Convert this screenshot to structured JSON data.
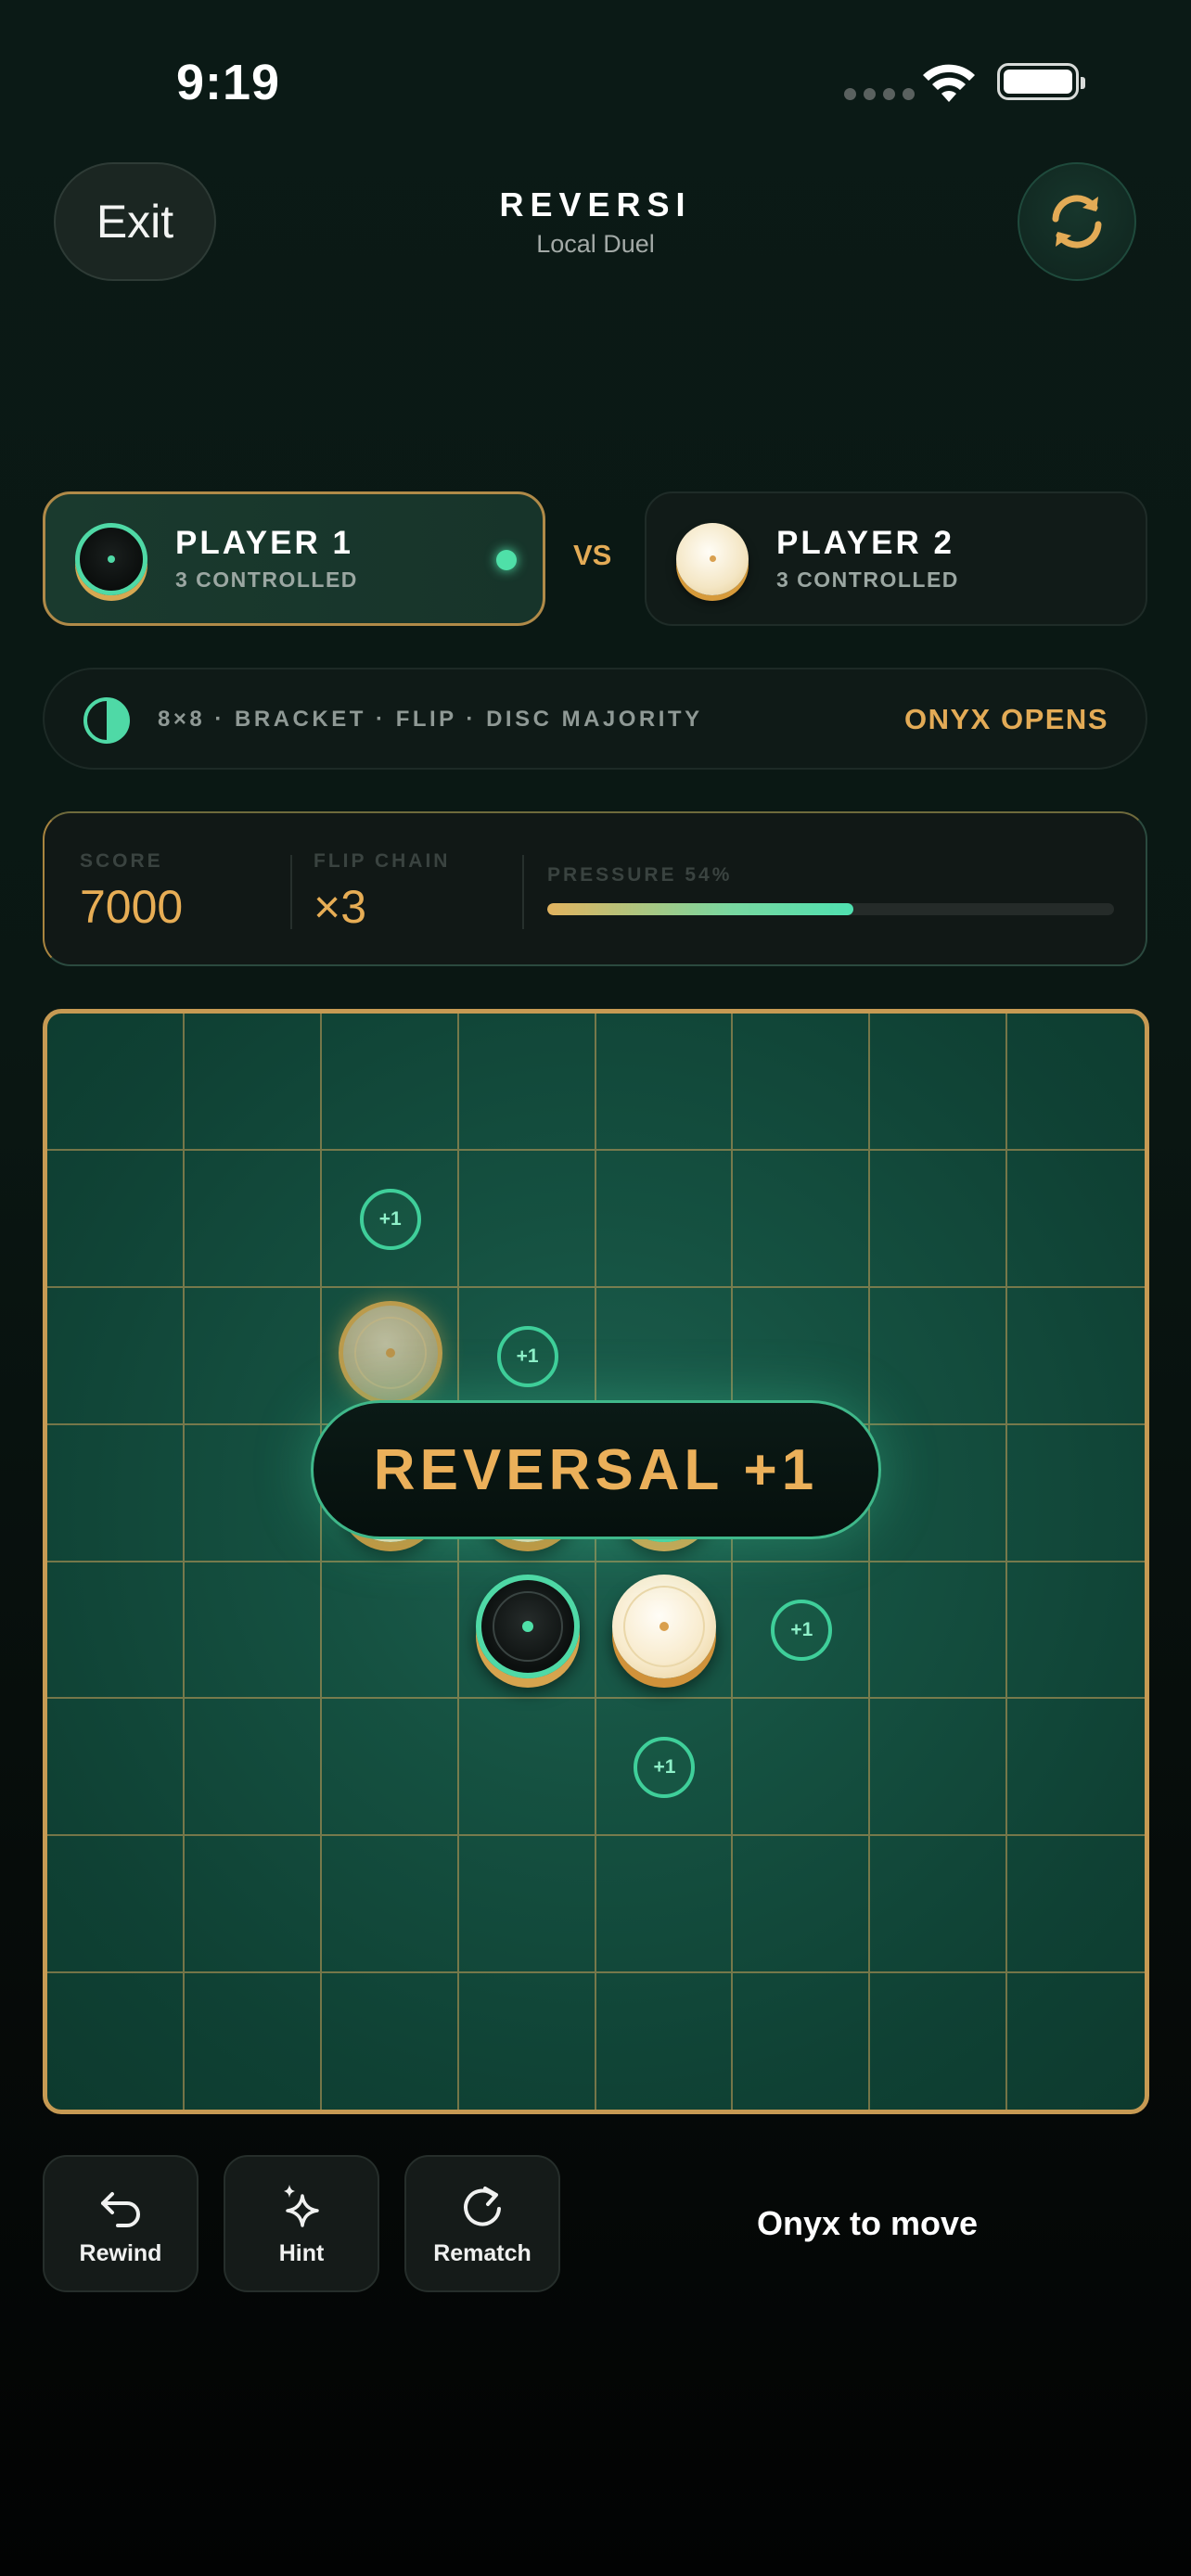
{
  "status_bar": {
    "time": "9:19"
  },
  "header": {
    "exit_label": "Exit",
    "title": "REVERSI",
    "subtitle": "Local Duel",
    "sync_icon": "sync-icon"
  },
  "players": [
    {
      "name": "PLAYER 1",
      "controlled": "3 CONTROLLED",
      "disc": "dark",
      "active": true
    },
    {
      "name": "PLAYER 2",
      "controlled": "3 CONTROLLED",
      "disc": "light",
      "active": false
    }
  ],
  "vs_label": "VS",
  "rules": {
    "text": "8×8 · BRACKET · FLIP · DISC MAJORITY",
    "opens": "ONYX OPENS"
  },
  "stats": {
    "score_label": "SCORE",
    "score_value": "7000",
    "chain_label": "FLIP CHAIN",
    "chain_value": "×3",
    "pressure_label": "PRESSURE 54%",
    "pressure_fraction": 0.54
  },
  "board": {
    "size": 8,
    "discs": [
      {
        "row": 2,
        "col": 2,
        "color": "ghost"
      },
      {
        "row": 3,
        "col": 2,
        "color": "light"
      },
      {
        "row": 3,
        "col": 3,
        "color": "light"
      },
      {
        "row": 3,
        "col": 4,
        "color": "dark"
      },
      {
        "row": 4,
        "col": 3,
        "color": "dark"
      },
      {
        "row": 4,
        "col": 4,
        "color": "light"
      }
    ],
    "hints": [
      {
        "row": 1,
        "col": 2,
        "label": "+1"
      },
      {
        "row": 2,
        "col": 3,
        "label": "+1"
      },
      {
        "row": 4,
        "col": 5,
        "label": "+1"
      },
      {
        "row": 5,
        "col": 4,
        "label": "+1"
      }
    ],
    "banner": "REVERSAL +1"
  },
  "controls": [
    {
      "label": "Rewind",
      "icon": "rewind-icon"
    },
    {
      "label": "Hint",
      "icon": "sparkle-icon"
    },
    {
      "label": "Rematch",
      "icon": "rematch-icon"
    }
  ],
  "turn_text": "Onyx to move",
  "colors": {
    "accent_gold": "#e3ab56",
    "accent_green": "#4fd9a6",
    "board_green": "#155141"
  }
}
